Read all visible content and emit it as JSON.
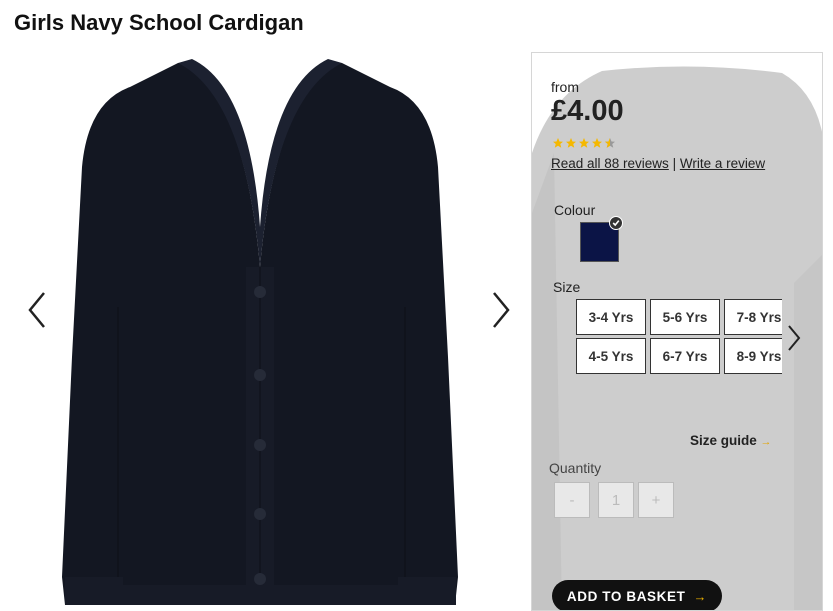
{
  "product": {
    "title": "Girls Navy School Cardigan",
    "price_prefix": "from",
    "price": "£4.00",
    "rating": 4.5,
    "reviews_link": "Read all 88 reviews",
    "separator": "|",
    "write_review_link": "Write a review"
  },
  "colour": {
    "label": "Colour",
    "selected_hex": "#0b1446"
  },
  "size": {
    "label": "Size",
    "options": [
      "3-4 Yrs",
      "5-6 Yrs",
      "7-8 Yrs",
      "4-5 Yrs",
      "6-7 Yrs",
      "8-9 Yrs"
    ],
    "guide_label": "Size guide",
    "guide_arrow": "→"
  },
  "quantity": {
    "label": "Quantity",
    "minus": "-",
    "value": "1",
    "plus": "+"
  },
  "basket": {
    "label": "ADD TO BASKET",
    "arrow": "→"
  },
  "colors": {
    "star": "#f5b800",
    "button_bg": "#111111",
    "accent": "#f0b400"
  }
}
